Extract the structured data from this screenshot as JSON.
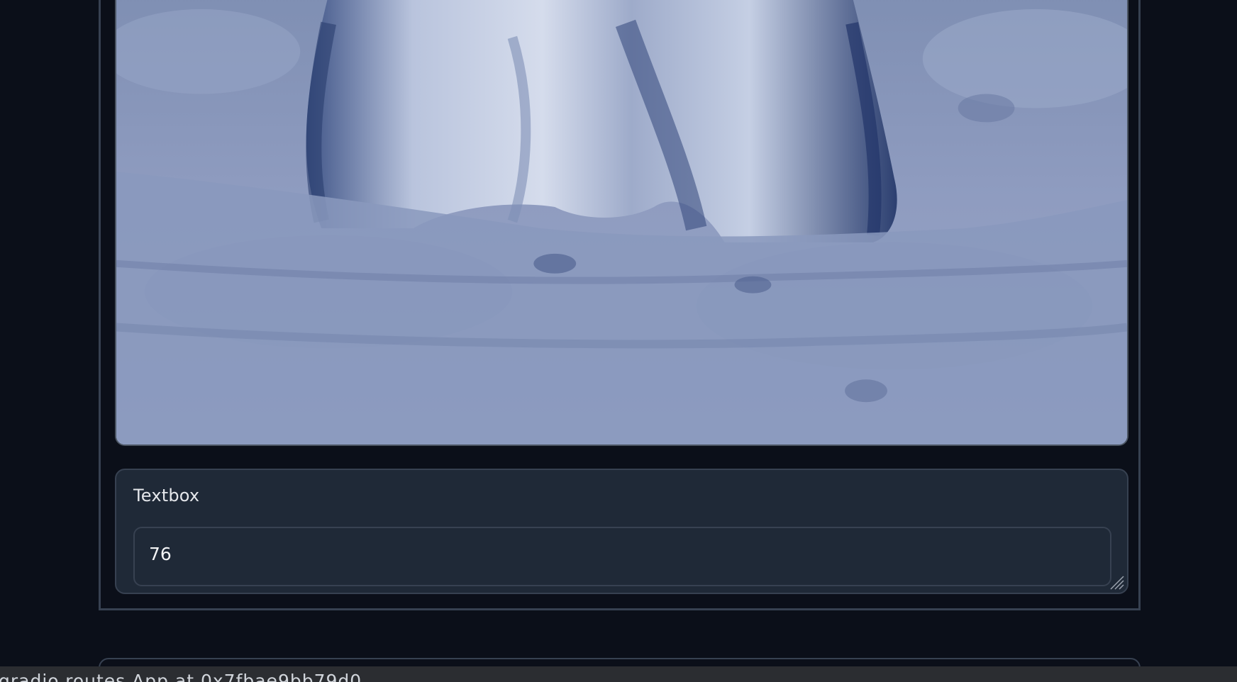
{
  "image": {
    "alt": "",
    "tint": "#8e9dbf"
  },
  "textbox": {
    "label": "Textbox",
    "value": "76"
  },
  "status_bar": {
    "text": "gradio.routes.App at 0x7fbae9bb79d0"
  },
  "colors": {
    "background": "#0b0f19",
    "panel": "#1f2937",
    "border": "#374151",
    "text": "#e5e7eb"
  }
}
